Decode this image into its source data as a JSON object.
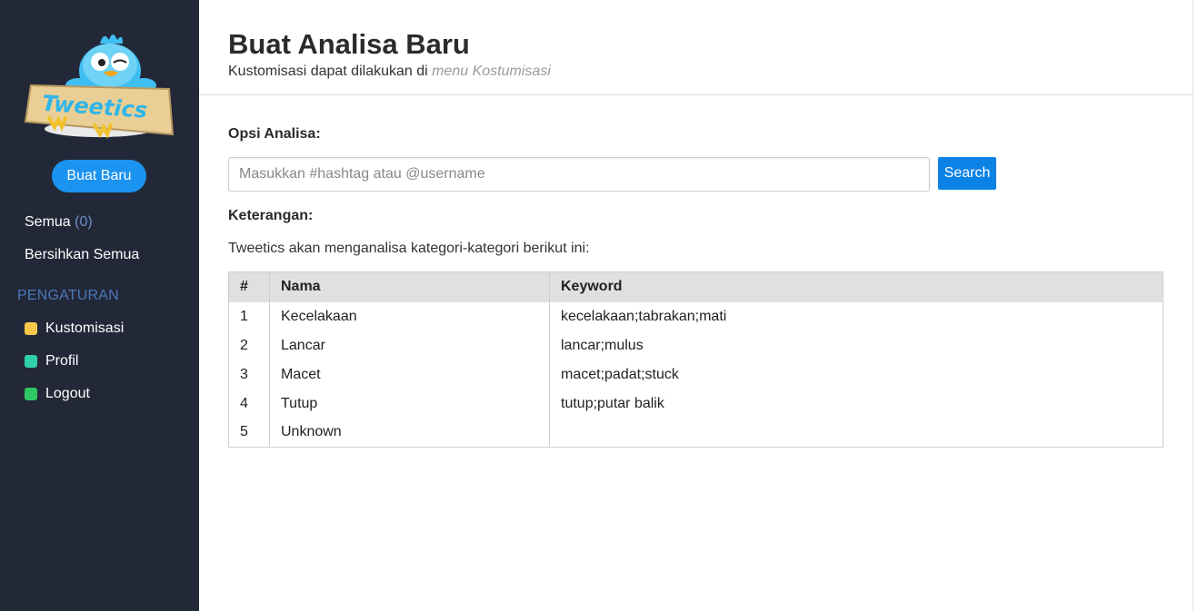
{
  "sidebar": {
    "logo_text": "Tweetics",
    "new_button": "Buat Baru",
    "items": [
      {
        "label": "Semua",
        "count": "(0)"
      },
      {
        "label": "Bersihkan Semua"
      }
    ],
    "settings_title": "PENGATURAN",
    "settings": [
      {
        "label": "Kustomisasi",
        "color": "#f5c84a"
      },
      {
        "label": "Profil",
        "color": "#2fcfa9"
      },
      {
        "label": "Logout",
        "color": "#2ec764"
      }
    ]
  },
  "header": {
    "title": "Buat Analisa Baru",
    "subtitle_prefix": "Kustomisasi dapat dilakukan di",
    "subtitle_link": "menu Kostumisasi"
  },
  "options": {
    "label": "Opsi Analisa:",
    "search_placeholder": "Masukkan #hashtag atau @username",
    "search_button": "Search"
  },
  "notes": {
    "label": "Keterangan:",
    "description": "Tweetics akan menganalisa kategori-kategori berikut ini:"
  },
  "table": {
    "headers": [
      "#",
      "Nama",
      "Keyword"
    ],
    "rows": [
      [
        "1",
        "Kecelakaan",
        "kecelakaan;tabrakan;mati"
      ],
      [
        "2",
        "Lancar",
        "lancar;mulus"
      ],
      [
        "3",
        "Macet",
        "macet;padat;stuck"
      ],
      [
        "4",
        "Tutup",
        "tutup;putar balik"
      ],
      [
        "5",
        "Unknown",
        ""
      ]
    ]
  },
  "colors": {
    "sidebar_bg": "#232838",
    "accent": "#1b93f0"
  }
}
